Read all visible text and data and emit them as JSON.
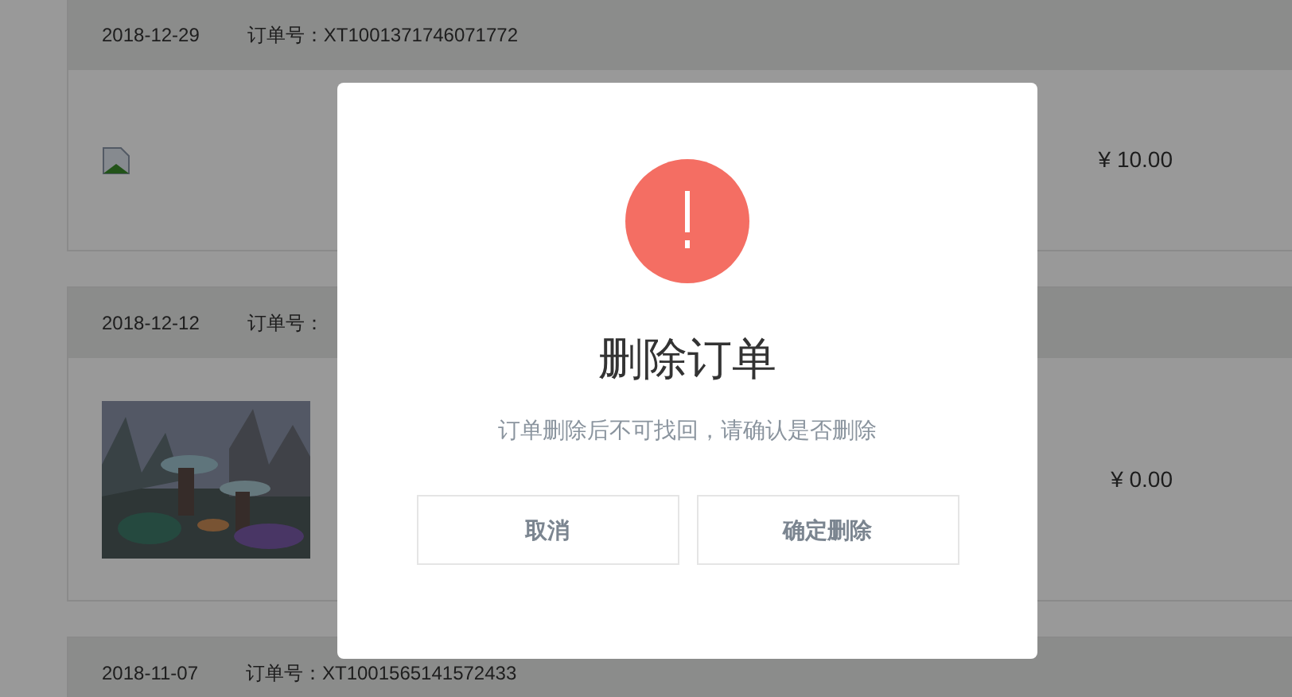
{
  "orders": [
    {
      "date": "2018-12-29",
      "order_no": "订单号：XT1001371746071772",
      "kind": "broken_image",
      "price": "¥ 10.00"
    },
    {
      "date": "2018-12-12",
      "order_no": "订单号：",
      "kind": "picture",
      "price": "¥ 0.00"
    },
    {
      "date": "2018-11-07",
      "order_no": "订单号：XT1001565141572433",
      "kind": "header_only"
    }
  ],
  "dialog": {
    "title": "删除订单",
    "message": "订单删除后不可找回，请确认是否删除",
    "buttons": [
      "取消",
      "确定删除"
    ]
  }
}
